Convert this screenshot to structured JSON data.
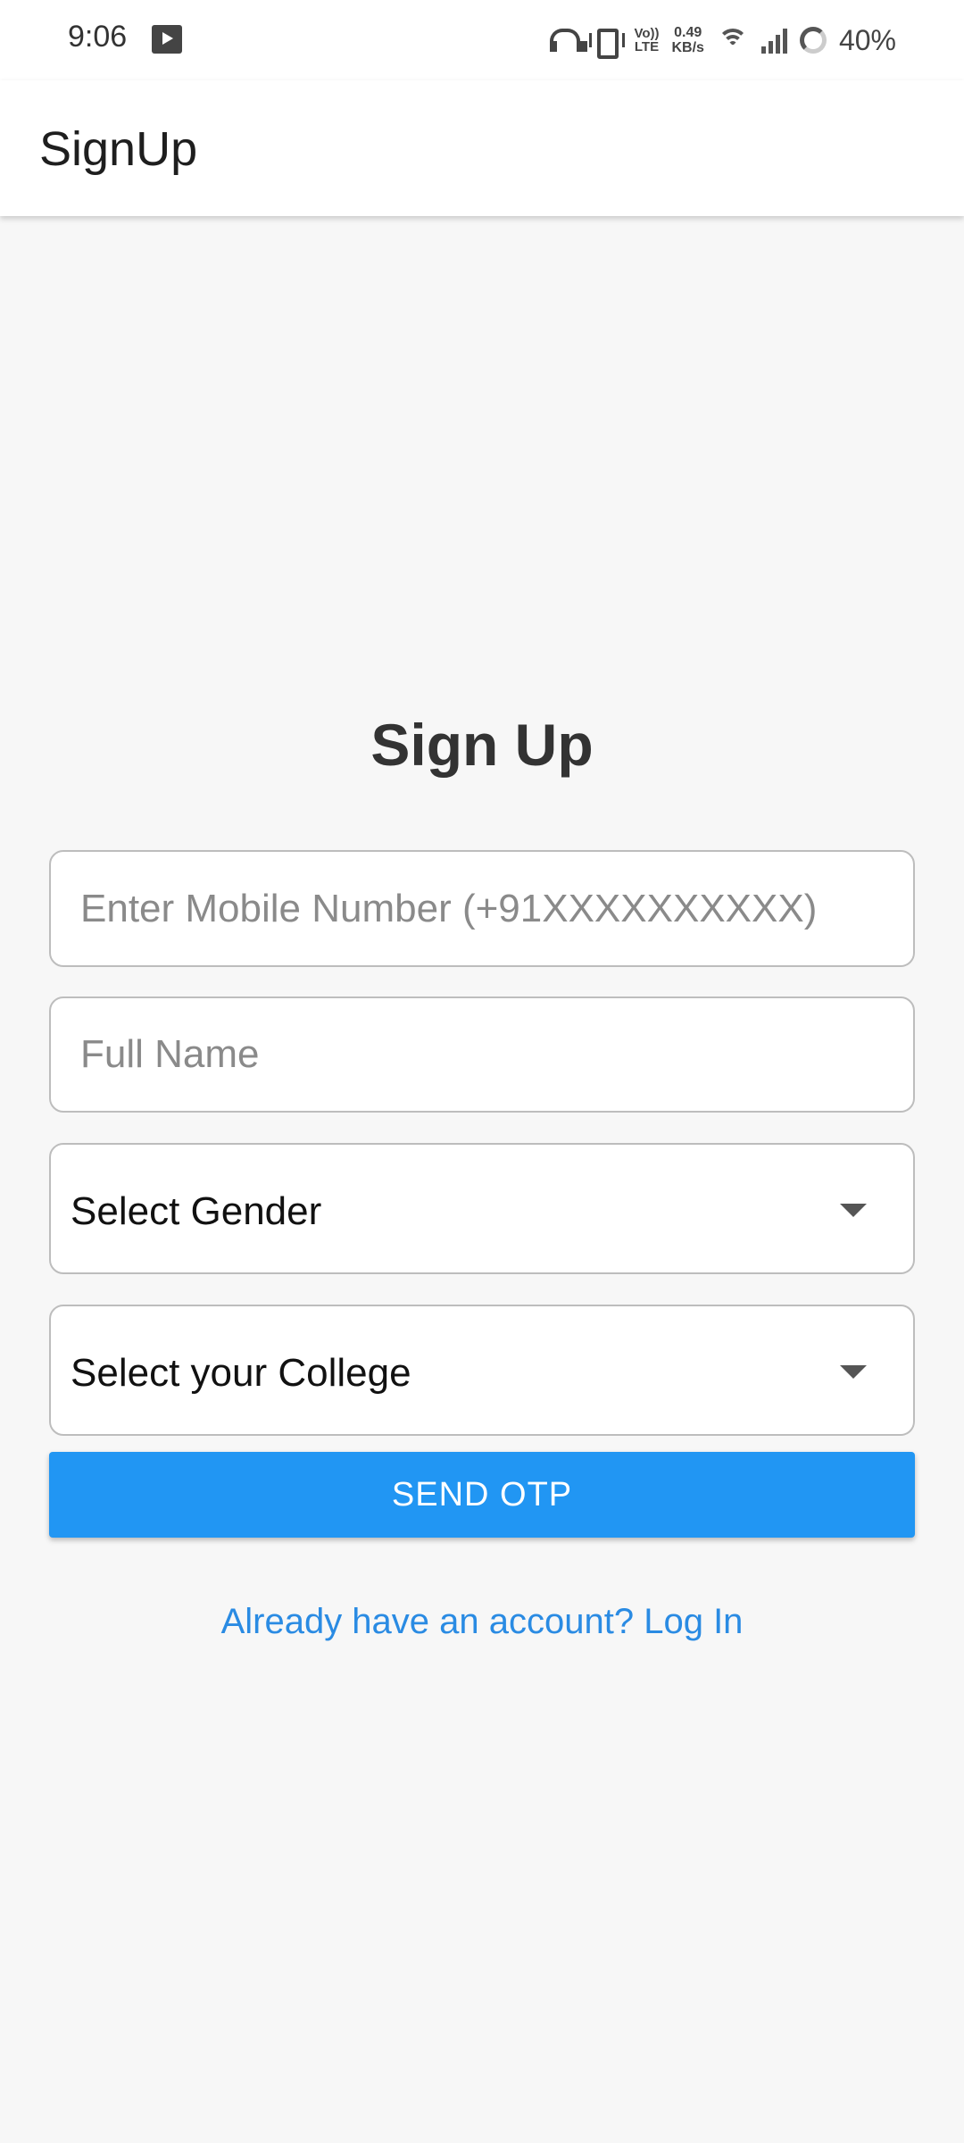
{
  "status_bar": {
    "time": "9:06",
    "volte_top": "Vo))",
    "volte_bottom": "LTE",
    "net_speed_value": "0.49",
    "net_speed_unit": "KB/s",
    "battery": "40%"
  },
  "app_bar": {
    "title": "SignUp"
  },
  "form": {
    "heading": "Sign Up",
    "mobile_placeholder": "Enter Mobile Number (+91XXXXXXXXXX)",
    "mobile_value": "",
    "name_placeholder": "Full Name",
    "name_value": "",
    "gender_select_label": "Select Gender",
    "college_select_label": "Select your College",
    "send_otp_label": "SEND OTP",
    "login_link": "Already have an account? Log In"
  },
  "colors": {
    "accent": "#2196f3",
    "link": "#2a8be3",
    "background": "#f7f7f7"
  },
  "icons": {
    "status": [
      "media-icon",
      "headphones-icon",
      "vibrate-icon",
      "volte-icon",
      "wifi-icon",
      "signal-icon",
      "battery-icon"
    ],
    "select_caret": "caret-down-icon"
  }
}
